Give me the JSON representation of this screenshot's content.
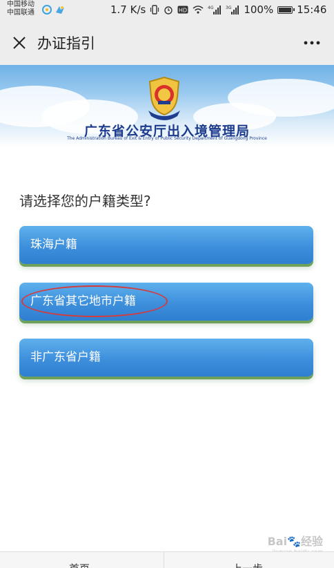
{
  "status_bar": {
    "carrier_1": "中国移动",
    "carrier_2": "中国联通",
    "network_speed": "1.7 K/s",
    "battery": "100%",
    "time": "15:46",
    "icons": [
      "vibrate-icon",
      "alarm-icon",
      "hd-icon",
      "wifi-icon",
      "signal-4g-icon",
      "signal-3g-icon",
      "battery-icon"
    ]
  },
  "header": {
    "title": "办证指引"
  },
  "banner": {
    "bureau_name": "广东省公安厅出入境管理局",
    "bureau_name_en": "The Administration Bureau of Exit & Entry of Public Security Department of Guangdong Province"
  },
  "main": {
    "question": "请选择您的户籍类型?",
    "options": [
      {
        "label": "珠海户籍"
      },
      {
        "label": "广东省其它地市户籍"
      },
      {
        "label": "非广东省户籍"
      }
    ],
    "highlight_color": "#d83a3a",
    "button_color": "#3d8fdc"
  },
  "bottom_nav": {
    "home": "首页",
    "prev": "上一步"
  },
  "watermark": {
    "brand": "Bai",
    "brand_suffix": "经验",
    "url": "jingyan.baidu.com"
  }
}
